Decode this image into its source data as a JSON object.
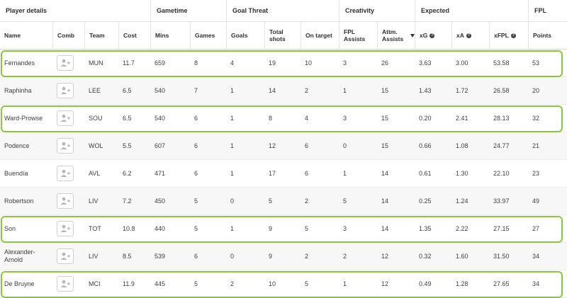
{
  "groups": [
    {
      "label": "Player details"
    },
    {
      "label": "Gametime"
    },
    {
      "label": "Goal Threat"
    },
    {
      "label": "Creativity"
    },
    {
      "label": "Expected"
    },
    {
      "label": "FPL"
    }
  ],
  "columns": [
    {
      "key": "name",
      "label": "Name"
    },
    {
      "key": "comb",
      "label": "Comb"
    },
    {
      "key": "team",
      "label": "Team"
    },
    {
      "key": "cost",
      "label": "Cost"
    },
    {
      "key": "mins",
      "label": "Mins"
    },
    {
      "key": "games",
      "label": "Games"
    },
    {
      "key": "goals",
      "label": "Goals"
    },
    {
      "key": "total_shots",
      "label": "Total shots"
    },
    {
      "key": "on_target",
      "label": "On target"
    },
    {
      "key": "fpl_assists",
      "label": "FPL Assists"
    },
    {
      "key": "attm_assists",
      "label": "Attm. Assists",
      "sorted": true,
      "sort_icon": "sort-desc-icon"
    },
    {
      "key": "xg",
      "label": "xG",
      "info_icon": "info-icon",
      "info_glyph": "?"
    },
    {
      "key": "xa",
      "label": "xA",
      "info_icon": "info-icon",
      "info_glyph": "?"
    },
    {
      "key": "xfpl",
      "label": "xFPL",
      "info_icon": "info-icon",
      "info_glyph": "?"
    },
    {
      "key": "points",
      "label": "Points"
    }
  ],
  "rows": [
    {
      "name": "Fernandes",
      "team": "MUN",
      "cost": "11.7",
      "mins": "659",
      "games": "8",
      "goals": "4",
      "total_shots": "19",
      "on_target": "10",
      "fpl_assists": "3",
      "attm_assists": "26",
      "xg": "3.63",
      "xa": "3.00",
      "xfpl": "53.58",
      "points": "53",
      "highlighted": true
    },
    {
      "name": "Raphinha",
      "team": "LEE",
      "cost": "6.5",
      "mins": "540",
      "games": "7",
      "goals": "1",
      "total_shots": "14",
      "on_target": "2",
      "fpl_assists": "1",
      "attm_assists": "15",
      "xg": "1.43",
      "xa": "1.72",
      "xfpl": "26.58",
      "points": "20",
      "highlighted": false
    },
    {
      "name": "Ward-Prowse",
      "team": "SOU",
      "cost": "6.5",
      "mins": "540",
      "games": "6",
      "goals": "1",
      "total_shots": "8",
      "on_target": "4",
      "fpl_assists": "3",
      "attm_assists": "15",
      "xg": "0.20",
      "xa": "2.41",
      "xfpl": "28.13",
      "points": "32",
      "highlighted": true
    },
    {
      "name": "Podence",
      "team": "WOL",
      "cost": "5.5",
      "mins": "607",
      "games": "6",
      "goals": "1",
      "total_shots": "12",
      "on_target": "6",
      "fpl_assists": "0",
      "attm_assists": "15",
      "xg": "0.66",
      "xa": "1.08",
      "xfpl": "24.77",
      "points": "21",
      "highlighted": false
    },
    {
      "name": "Buendía",
      "team": "AVL",
      "cost": "6.2",
      "mins": "471",
      "games": "6",
      "goals": "1",
      "total_shots": "17",
      "on_target": "6",
      "fpl_assists": "1",
      "attm_assists": "14",
      "xg": "0.61",
      "xa": "1.30",
      "xfpl": "22.10",
      "points": "23",
      "highlighted": false
    },
    {
      "name": "Robertson",
      "team": "LIV",
      "cost": "7.2",
      "mins": "450",
      "games": "5",
      "goals": "0",
      "total_shots": "5",
      "on_target": "2",
      "fpl_assists": "5",
      "attm_assists": "14",
      "xg": "0.25",
      "xa": "1.24",
      "xfpl": "33.97",
      "points": "49",
      "highlighted": false
    },
    {
      "name": "Son",
      "team": "TOT",
      "cost": "10.8",
      "mins": "440",
      "games": "5",
      "goals": "1",
      "total_shots": "9",
      "on_target": "5",
      "fpl_assists": "3",
      "attm_assists": "14",
      "xg": "1.35",
      "xa": "2.22",
      "xfpl": "27.15",
      "points": "27",
      "highlighted": true
    },
    {
      "name": "Alexander-Arnold",
      "team": "LIV",
      "cost": "8.5",
      "mins": "539",
      "games": "6",
      "goals": "0",
      "total_shots": "9",
      "on_target": "2",
      "fpl_assists": "2",
      "attm_assists": "12",
      "xg": "0.32",
      "xa": "1.60",
      "xfpl": "31.50",
      "points": "34",
      "highlighted": false
    },
    {
      "name": "De Bruyne",
      "team": "MCI",
      "cost": "11.9",
      "mins": "445",
      "games": "5",
      "goals": "2",
      "total_shots": "10",
      "on_target": "5",
      "fpl_assists": "1",
      "attm_assists": "12",
      "xg": "0.49",
      "xa": "1.28",
      "xfpl": "27.65",
      "points": "34",
      "highlighted": true
    }
  ],
  "comb_icon": "add-player-icon",
  "colors": {
    "highlight": "#8cc63f",
    "alt_row": "#f7f7f7",
    "border": "#e3e3e3",
    "text": "#3d3d3d"
  }
}
